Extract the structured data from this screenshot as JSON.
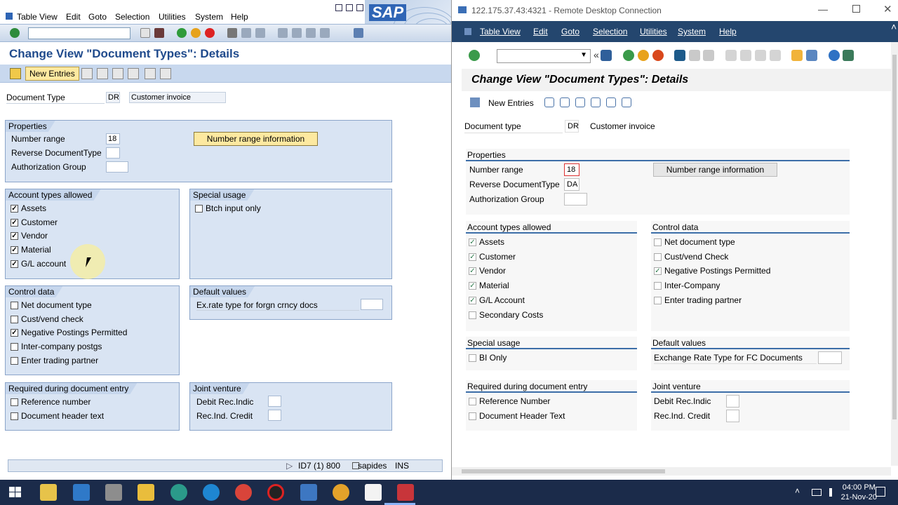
{
  "left": {
    "menu": [
      "Table View",
      "Edit",
      "Goto",
      "Selection",
      "Utilities",
      "System",
      "Help"
    ],
    "logo": "SAP",
    "title": "Change View \"Document Types\": Details",
    "new_entries": "New Entries",
    "doc_type_label": "Document Type",
    "doc_type_value": "DR",
    "doc_type_desc": "Customer invoice",
    "properties": {
      "title": "Properties",
      "number_range_label": "Number range",
      "number_range_value": "18",
      "reverse_label": "Reverse DocumentType",
      "auth_label": "Authorization Group",
      "nr_button": "Number range information"
    },
    "account_types": {
      "title": "Account types allowed",
      "items": [
        {
          "label": "Assets",
          "checked": true
        },
        {
          "label": "Customer",
          "checked": true
        },
        {
          "label": "Vendor",
          "checked": true
        },
        {
          "label": "Material",
          "checked": true
        },
        {
          "label": "G/L account",
          "checked": true
        }
      ]
    },
    "special_usage": {
      "title": "Special usage",
      "items": [
        {
          "label": "Btch input only",
          "checked": false
        }
      ]
    },
    "control_data": {
      "title": "Control data",
      "items": [
        {
          "label": "Net document type",
          "checked": false
        },
        {
          "label": "Cust/vend check",
          "checked": false
        },
        {
          "label": "Negative Postings Permitted",
          "checked": true
        },
        {
          "label": "Inter-company postgs",
          "checked": false
        },
        {
          "label": "Enter trading partner",
          "checked": false
        }
      ]
    },
    "default_values": {
      "title": "Default values",
      "exrate_label": "Ex.rate type for forgn crncy docs"
    },
    "required": {
      "title": "Required during document entry",
      "items": [
        {
          "label": "Reference number",
          "checked": false
        },
        {
          "label": "Document header text",
          "checked": false
        }
      ]
    },
    "joint_venture": {
      "title": "Joint venture",
      "debit_label": "Debit Rec.Indic",
      "credit_label": "Rec.Ind. Credit"
    },
    "status": {
      "system": "ID7 (1) 800",
      "server": "sapides",
      "mode": "INS"
    }
  },
  "right": {
    "rdp_title": "122.175.37.43:4321 - Remote Desktop Connection",
    "menu": [
      "Table View",
      "Edit",
      "Goto",
      "Selection",
      "Utilities",
      "System",
      "Help"
    ],
    "title": "Change View \"Document Types\": Details",
    "new_entries": "New Entries",
    "doc_type_label": "Document type",
    "doc_type_value": "DR",
    "doc_type_desc": "Customer invoice",
    "properties": {
      "title": "Properties",
      "number_range_label": "Number range",
      "number_range_value": "18",
      "reverse_label": "Reverse DocumentType",
      "reverse_value": "DA",
      "auth_label": "Authorization Group",
      "nr_button": "Number range information"
    },
    "account_types": {
      "title": "Account types allowed",
      "items": [
        {
          "label": "Assets",
          "checked": true
        },
        {
          "label": "Customer",
          "checked": true
        },
        {
          "label": "Vendor",
          "checked": true
        },
        {
          "label": "Material",
          "checked": true
        },
        {
          "label": "G/L Account",
          "checked": true
        },
        {
          "label": "Secondary Costs",
          "checked": false
        }
      ]
    },
    "control_data": {
      "title": "Control data",
      "items": [
        {
          "label": "Net document type",
          "checked": false
        },
        {
          "label": "Cust/vend Check",
          "checked": false
        },
        {
          "label": "Negative Postings Permitted",
          "checked": true
        },
        {
          "label": "Inter-Company",
          "checked": false
        },
        {
          "label": "Enter trading partner",
          "checked": false
        }
      ]
    },
    "special_usage": {
      "title": "Special usage",
      "items": [
        {
          "label": "BI Only",
          "checked": false
        }
      ]
    },
    "default_values": {
      "title": "Default values",
      "exrate_label": "Exchange Rate Type for FC Documents"
    },
    "required": {
      "title": "Required during document entry",
      "items": [
        {
          "label": "Reference Number",
          "checked": false
        },
        {
          "label": "Document Header Text",
          "checked": false
        }
      ]
    },
    "joint_venture": {
      "title": "Joint venture",
      "debit_label": "Debit Rec.Indic",
      "credit_label": "Rec.Ind. Credit"
    }
  },
  "taskbar": {
    "time": "04:00 PM",
    "date": "21-Nov-20"
  },
  "colors": {
    "sap_blue": "#1f4a8c",
    "belize_nav": "#24466e",
    "accent": "#3c6ea8"
  }
}
